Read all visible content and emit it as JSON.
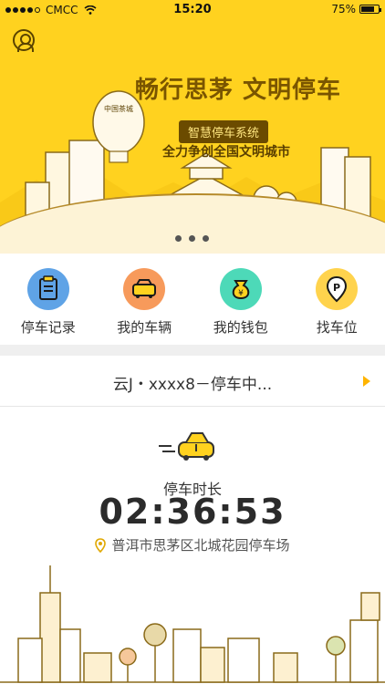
{
  "statusbar": {
    "carrier": "CMCC",
    "time": "15:20",
    "battery": "75%"
  },
  "banner": {
    "title": "畅行思茅 文明停车",
    "badge": "智慧停车系统",
    "subtitle": "全力争创全国文明城市",
    "balloon_text": "中国茶城"
  },
  "actions": [
    {
      "label": "停车记录",
      "color": "#5fa3e6",
      "icon": "clipboard-icon"
    },
    {
      "label": "我的车辆",
      "color": "#f79a5b",
      "icon": "car-icon"
    },
    {
      "label": "我的钱包",
      "color": "#4dd9b8",
      "icon": "money-bag-icon"
    },
    {
      "label": "找车位",
      "color": "#ffd34d",
      "icon": "parking-icon"
    }
  ],
  "current": {
    "text": "云J・xxxx8－停车中..."
  },
  "timer": {
    "label": "停车时长",
    "duration": "02:36:53",
    "location": "普洱市思茅区北城花园停车场"
  },
  "colors": {
    "brand": "#ffd21f",
    "accent": "#ffb400"
  }
}
